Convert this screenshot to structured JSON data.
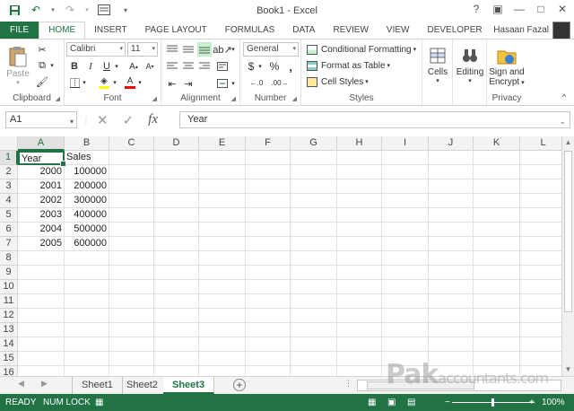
{
  "window": {
    "title": "Book1 - Excel",
    "help": "?",
    "restore": "▣",
    "minimize": "—",
    "maximize": "□",
    "close": "✕"
  },
  "qat": {
    "save": "💾",
    "undo": "↶",
    "redo": "↷",
    "customize": "▾"
  },
  "tabs": [
    "FILE",
    "HOME",
    "INSERT",
    "PAGE LAYOUT",
    "FORMULAS",
    "DATA",
    "REVIEW",
    "VIEW",
    "DEVELOPER"
  ],
  "user": "Hasaan Fazal",
  "ribbon": {
    "clipboard": {
      "label": "Clipboard",
      "paste": "Paste"
    },
    "font": {
      "label": "Font",
      "name": "Calibri",
      "size": "11",
      "bold": "B",
      "italic": "I",
      "underline": "U"
    },
    "alignment": {
      "label": "Alignment"
    },
    "number": {
      "label": "Number",
      "format": "General",
      "currency": "$",
      "percent": "%",
      "comma": ","
    },
    "styles": {
      "label": "Styles",
      "conditional": "Conditional Formatting",
      "table": "Format as Table",
      "cell_styles": "Cell Styles"
    },
    "cells": {
      "label": "Cells"
    },
    "editing": {
      "label": "Editing"
    },
    "privacy": {
      "label": "Privacy",
      "sign": "Sign and",
      "encrypt": "Encrypt"
    }
  },
  "formula_bar": {
    "name_box": "A1",
    "value": "Year"
  },
  "columns": [
    "A",
    "B",
    "C",
    "D",
    "E",
    "F",
    "G",
    "H",
    "I",
    "J",
    "K",
    "L"
  ],
  "rows": [
    "1",
    "2",
    "3",
    "4",
    "5",
    "6",
    "7",
    "8",
    "9",
    "10",
    "11",
    "12",
    "13",
    "14",
    "15",
    "16"
  ],
  "cells": {
    "A1": "Year",
    "B1": "Sales",
    "A2": "2000",
    "B2": "100000",
    "A3": "2001",
    "B3": "200000",
    "A4": "2002",
    "B4": "300000",
    "A5": "2003",
    "B5": "400000",
    "A6": "2004",
    "B6": "500000",
    "A7": "2005",
    "B7": "600000"
  },
  "sheets": [
    "Sheet1",
    "Sheet2",
    "Sheet3"
  ],
  "active_sheet": "Sheet3",
  "status": {
    "ready": "READY",
    "numlock": "NUM LOCK",
    "zoom": "100%"
  },
  "watermark": {
    "main": "Pak",
    "rest": "accountants.com"
  },
  "colors": {
    "accent": "#217346",
    "selection": "#c6efce"
  }
}
